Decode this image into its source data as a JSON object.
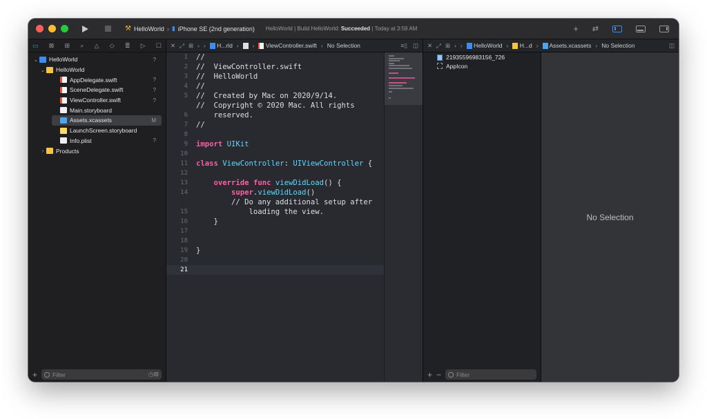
{
  "titlebar": {
    "scheme": "HelloWorld",
    "device": "iPhone SE (2nd generation)",
    "status_project": "HelloWorld",
    "status_action": "Build HelloWorld:",
    "status_result": "Succeeded",
    "status_time": "Today at 3:59 AM"
  },
  "colors": {
    "close": "#ff5f57",
    "minimize": "#febc2e",
    "zoom": "#28c840",
    "accent": "#3c8df0",
    "keyword": "#fc5fa3",
    "type": "#5dd8ff",
    "comment": "#7f8c98"
  },
  "navigator": {
    "tree": [
      {
        "label": "HelloWorld",
        "badge": "?",
        "disclosure": "⌄",
        "icon": "project-icon",
        "indent": 0
      },
      {
        "label": "HelloWorld",
        "badge": "",
        "disclosure": "⌄",
        "icon": "folder-icon",
        "indent": 1
      },
      {
        "label": "AppDelegate.swift",
        "badge": "?",
        "disclosure": "",
        "icon": "swift-file-icon",
        "indent": 2
      },
      {
        "label": "SceneDelegate.swift",
        "badge": "?",
        "disclosure": "",
        "icon": "swift-file-icon",
        "indent": 2
      },
      {
        "label": "ViewController.swift",
        "badge": "?",
        "disclosure": "",
        "icon": "swift-file-icon",
        "indent": 2
      },
      {
        "label": "Main.storyboard",
        "badge": "",
        "disclosure": "",
        "icon": "storyboard-icon",
        "indent": 2
      },
      {
        "label": "Assets.xcassets",
        "badge": "M",
        "disclosure": "",
        "icon": "xcassets-icon",
        "indent": 2,
        "selected": true
      },
      {
        "label": "LaunchScreen.storyboard",
        "badge": "",
        "disclosure": "",
        "icon": "launchscreen-icon",
        "indent": 2
      },
      {
        "label": "Info.plist",
        "badge": "?",
        "disclosure": "",
        "icon": "plist-icon",
        "indent": 2
      },
      {
        "label": "Products",
        "badge": "",
        "disclosure": "›",
        "icon": "folder-icon",
        "indent": 1
      }
    ],
    "filter_placeholder": "Filter"
  },
  "editor": {
    "jump_short": "H...rld",
    "jump_file": "ViewController.swift",
    "jump_selection": "No Selection",
    "lines": [
      {
        "n": "1",
        "text": "//",
        "cls": "c-cmt"
      },
      {
        "n": "2",
        "text": "//  ViewController.swift",
        "cls": "c-cmt"
      },
      {
        "n": "3",
        "text": "//  HelloWorld",
        "cls": "c-cmt"
      },
      {
        "n": "4",
        "text": "//",
        "cls": "c-cmt"
      },
      {
        "n": "5",
        "text": "//  Created by Mac on 2020/9/14.",
        "cls": "c-cmt"
      },
      {
        "n": "6",
        "text": "//  Copyright © 2020 Mac. All rights\n    reserved.",
        "cls": "c-cmt",
        "tall": true
      },
      {
        "n": "7",
        "text": "//",
        "cls": "c-cmt"
      },
      {
        "n": "8",
        "text": "",
        "cls": "c-plain"
      },
      {
        "n": "9",
        "text": "import UIKit",
        "cls": "mixed-import"
      },
      {
        "n": "10",
        "text": "",
        "cls": "c-plain"
      },
      {
        "n": "11",
        "text": "class ViewController: UIViewController {",
        "cls": "mixed-class"
      },
      {
        "n": "12",
        "text": "",
        "cls": "c-plain"
      },
      {
        "n": "13",
        "text": "    override func viewDidLoad() {",
        "cls": "mixed-override"
      },
      {
        "n": "14",
        "text": "        super.viewDidLoad()",
        "cls": "mixed-super"
      },
      {
        "n": "15",
        "text": "        // Do any additional setup after\n            loading the view.",
        "cls": "c-cmt",
        "tall": true
      },
      {
        "n": "16",
        "text": "    }",
        "cls": "c-plain"
      },
      {
        "n": "17",
        "text": "",
        "cls": "c-plain"
      },
      {
        "n": "18",
        "text": "",
        "cls": "c-plain"
      },
      {
        "n": "19",
        "text": "}",
        "cls": "c-plain"
      },
      {
        "n": "20",
        "text": "",
        "cls": "c-plain"
      },
      {
        "n": "21",
        "text": "",
        "cls": "c-plain",
        "current": true
      }
    ]
  },
  "assets": {
    "jump_project": "HelloWorld",
    "jump_short": "H...d",
    "jump_catalog": "Assets.xcassets",
    "jump_selection": "No Selection",
    "items": [
      {
        "label": "21935596983156_726",
        "icon": "image-set-icon"
      },
      {
        "label": "AppIcon",
        "icon": "app-icon-set-icon"
      }
    ],
    "detail_text": "No Selection",
    "filter_placeholder": "Filter"
  }
}
